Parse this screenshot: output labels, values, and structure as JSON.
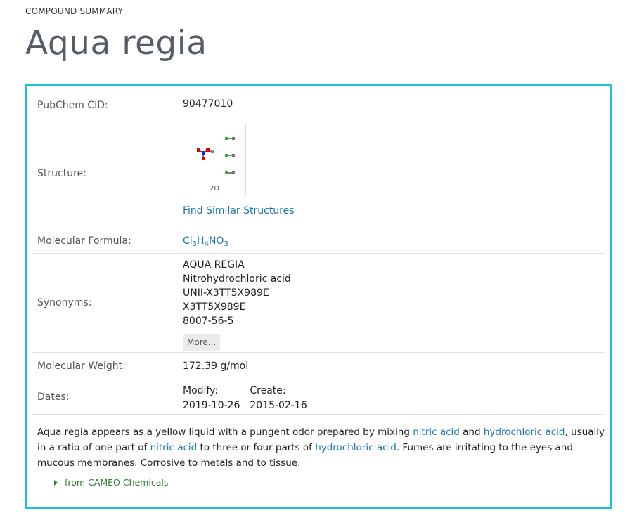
{
  "header": {
    "eyebrow": "COMPOUND SUMMARY",
    "title": "Aqua regia"
  },
  "summary": {
    "cid": {
      "label": "PubChem CID:",
      "value": "90477010"
    },
    "structure": {
      "label": "Structure:",
      "thumb_label": "2D",
      "find_similar": "Find Similar Structures"
    },
    "formula": {
      "label": "Molecular Formula:",
      "parts": [
        "Cl",
        "3",
        "H",
        "4",
        "NO",
        "3"
      ]
    },
    "synonyms": {
      "label": "Synonyms:",
      "items": [
        "AQUA REGIA",
        "Nitrohydrochloric acid",
        "UNII-X3TT5X989E",
        "X3TT5X989E",
        "8007-56-5"
      ],
      "more": "More..."
    },
    "weight": {
      "label": "Molecular Weight:",
      "value": "172.39 g/mol"
    },
    "dates": {
      "label": "Dates:",
      "modify_label": "Modify:",
      "modify_value": "2019-10-26",
      "create_label": "Create:",
      "create_value": "2015-02-16"
    }
  },
  "description": {
    "t1": "Aqua regia appears as a yellow liquid with a pungent odor prepared by mixing ",
    "l1": "nitric acid",
    "t2": " and ",
    "l2": "hydrochloric acid",
    "t3": ", usually in a ratio of one part of ",
    "l3": "nitric acid",
    "t4": " to three or four parts of ",
    "l4": "hydrochloric acid",
    "t5": ". Fumes are irritating to the eyes and mucous membranes. Corrosive to metals and to tissue.",
    "source": "from CAMEO Chemicals"
  },
  "icons": {
    "expand": "triangle-right-icon",
    "structure": "molecule-structure-icon"
  },
  "colors": {
    "accent_border": "#1ebfde",
    "link": "#1b74b3",
    "source_green": "#2e7d32",
    "title_gray": "#555d66"
  }
}
